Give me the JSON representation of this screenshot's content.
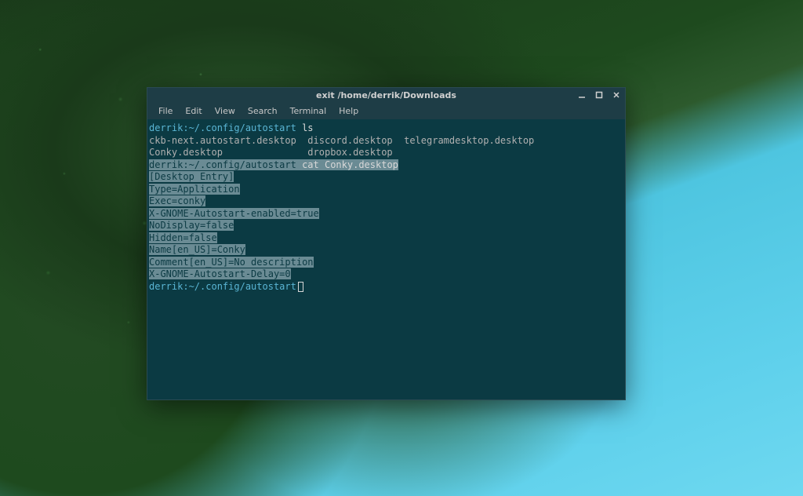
{
  "window": {
    "title": "exit /home/derrik/Downloads"
  },
  "menubar": {
    "items": [
      "File",
      "Edit",
      "View",
      "Search",
      "Terminal",
      "Help"
    ]
  },
  "terminal": {
    "prompt_text": "derrik:~/.config/autostart",
    "line1_cmd": " ls",
    "ls_output_line1": "ckb-next.autostart.desktop  discord.desktop  telegramdesktop.desktop",
    "ls_output_line2": "Conky.desktop               dropbox.desktop",
    "line3_cmd": " cat Conky.desktop",
    "cat_output": [
      "[Desktop Entry]",
      "Type=Application",
      "Exec=conky",
      "X-GNOME-Autostart-enabled=true",
      "NoDisplay=false",
      "Hidden=false",
      "Name[en_US]=Conky",
      "Comment[en_US]=No description",
      "X-GNOME-Autostart-Delay=0"
    ]
  }
}
